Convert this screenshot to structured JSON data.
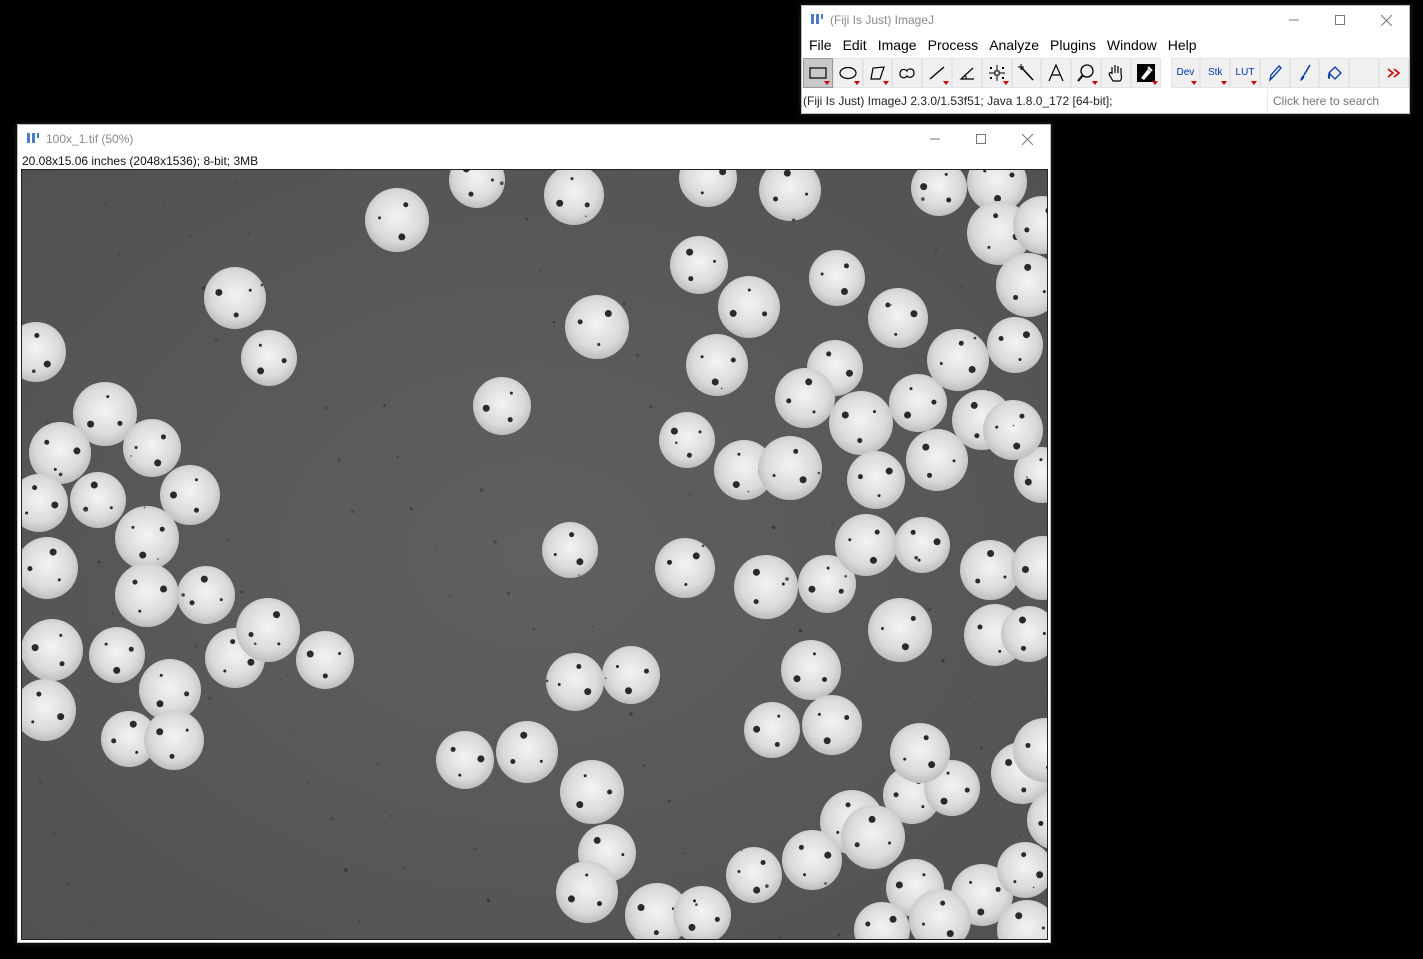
{
  "imagej_window": {
    "title": "(Fiji Is Just) ImageJ",
    "menu": [
      "File",
      "Edit",
      "Image",
      "Process",
      "Analyze",
      "Plugins",
      "Window",
      "Help"
    ],
    "tools": {
      "dev_label": "Dev",
      "stk_label": "Stk",
      "lut_label": "LUT"
    },
    "status": "(Fiji Is Just) ImageJ 2.3.0/1.53f51; Java 1.8.0_172 [64-bit];",
    "search_placeholder": "Click here to search"
  },
  "image_window": {
    "title": "100x_1.tif (50%)",
    "info": "20.08x15.06 inches (2048x1536); 8-bit; 3MB"
  },
  "colors": {
    "desktop": "#000000",
    "window_bg": "#ffffff",
    "image_background_gray": "#5a5a5a",
    "particle_gray": "#d8d8d8",
    "accent_red": "#cc0000",
    "tool_blue": "#0038a8"
  }
}
